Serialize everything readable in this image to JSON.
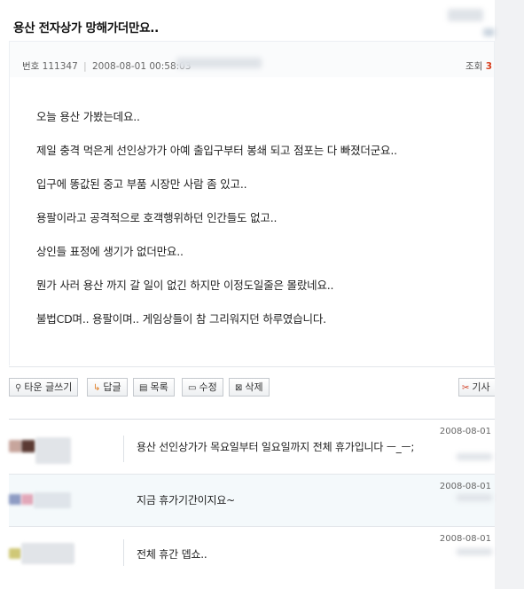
{
  "post": {
    "title": "용산 전자상가 망해가더만요..",
    "meta": {
      "number_label": "번호",
      "number": "111347",
      "datetime": "2008-08-01 00:58:03"
    },
    "views_label": "조회",
    "views_value": "3",
    "body": [
      "오늘 용산 가봤는데요..",
      "제일 충격 먹은게 선인상가가 아예 출입구부터 봉쇄 되고 점포는 다 빠졌더군요..",
      "입구에 똥값된 중고 부품 시장만 사람 좀 있고..",
      "용팔이라고 공격적으로 호객행위하던 인간들도 없고..",
      "상인들 표정에 생기가 없더만요..",
      "뭔가 사러 용산 까지 갈 일이 없긴 하지만 이정도일줄은 몰랐네요..",
      "불법CD며.. 용팔이며.. 게임상들이 참 그리워지던 하루였습니다."
    ]
  },
  "toolbar": {
    "write": {
      "icon": "pin-icon",
      "label": "타운 글쓰기"
    },
    "reply": {
      "icon": "reply-arrow-icon",
      "label": "답글"
    },
    "list": {
      "icon": "list-icon",
      "label": "목록"
    },
    "edit": {
      "icon": "edit-icon",
      "label": "수정"
    },
    "delete": {
      "icon": "delete-icon",
      "label": "삭제"
    },
    "scrap": {
      "icon": "scrap-icon",
      "label": "기사"
    }
  },
  "comments": [
    {
      "text": "용산 선인상가가 목요일부터 일요일까지 전체 휴가입니다 ㅡ_ㅡ;",
      "date": "2008-08-01"
    },
    {
      "text": "지금 휴가기간이지요~",
      "date": "2008-08-01"
    },
    {
      "text": "전체 휴간 뎁쇼..",
      "date": "2008-08-01"
    }
  ],
  "colors": {
    "views_accent": "#d8401f",
    "comment_highlight": "#f4f9fb",
    "scrap_icon": "#d23a1f"
  }
}
